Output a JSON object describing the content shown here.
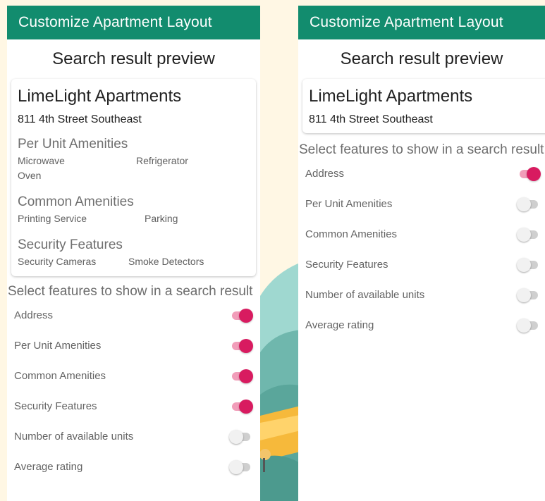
{
  "appbar": {
    "title": "Customize Apartment Layout"
  },
  "preview": {
    "heading": "Search result preview"
  },
  "listing": {
    "name": "LimeLight Apartments",
    "address": "811 4th Street Southeast",
    "per_unit": {
      "heading": "Per Unit Amenities",
      "items": [
        "Microwave",
        "Refrigerator",
        "Oven"
      ]
    },
    "common": {
      "heading": "Common Amenities",
      "items": [
        "Printing Service",
        "Parking"
      ]
    },
    "security": {
      "heading": "Security Features",
      "items": [
        "Security Cameras",
        "Smoke Detectors"
      ]
    }
  },
  "features": {
    "label": "Select features to show in a search result",
    "options": [
      {
        "label": "Address"
      },
      {
        "label": "Per Unit Amenities"
      },
      {
        "label": "Common Amenities"
      },
      {
        "label": "Security Features"
      },
      {
        "label": "Number of available units"
      },
      {
        "label": "Average rating"
      }
    ]
  },
  "screens": {
    "left": {
      "toggles_on": [
        true,
        true,
        true,
        true,
        false,
        false
      ]
    },
    "right": {
      "toggles_on": [
        true,
        false,
        false,
        false,
        false,
        false
      ]
    }
  },
  "colors": {
    "appbar": "#128c6e",
    "switch_on": "#d81b60",
    "switch_on_track": "#f19db9",
    "switch_off": "#f1f1f1",
    "switch_off_track": "#cfcfcf",
    "background": "#fff7e4"
  }
}
